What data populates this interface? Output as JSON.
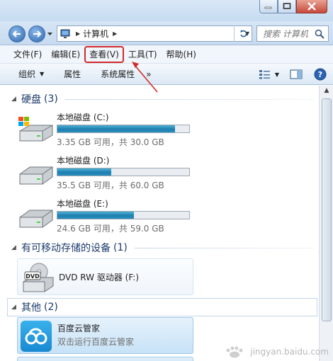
{
  "window": {
    "caption_buttons": [
      "minimize",
      "maximize",
      "close"
    ]
  },
  "nav": {
    "breadcrumb": [
      "计算机"
    ],
    "search_placeholder": "搜索 计算机"
  },
  "menu": {
    "items": [
      {
        "label": "文件(F)"
      },
      {
        "label": "编辑(E)"
      },
      {
        "label": "查看(V)",
        "highlighted": true
      },
      {
        "label": "工具(T)"
      },
      {
        "label": "帮助(H)"
      }
    ]
  },
  "toolbar": {
    "organize": "组织",
    "properties": "属性",
    "system_properties": "系统属性",
    "more": "»"
  },
  "groups": {
    "hard_disks": {
      "title": "硬盘",
      "count": "(3)"
    },
    "removable": {
      "title": "有可移动存储的设备",
      "count": "(1)"
    },
    "other": {
      "title": "其他",
      "count": "(2)"
    }
  },
  "drives": [
    {
      "name": "本地磁盘 (C:)",
      "info": "3.35 GB 可用，共 30.0 GB",
      "used_fraction": 0.89
    },
    {
      "name": "本地磁盘 (D:)",
      "info": "35.5 GB 可用，共 60.0 GB",
      "used_fraction": 0.41
    },
    {
      "name": "本地磁盘 (E:)",
      "info": "24.6 GB 可用，共 59.0 GB",
      "used_fraction": 0.58
    }
  ],
  "removable": {
    "name": "DVD RW 驱动器 (F:)",
    "icon_label": "DVD"
  },
  "other": {
    "name": "百度云管家",
    "desc": "双击运行百度云管家"
  },
  "colors": {
    "highlight_box": "#d22a2a",
    "drive_fill": "#1e7fb0"
  },
  "watermark": {
    "text": "jingyan.baidu.com"
  }
}
